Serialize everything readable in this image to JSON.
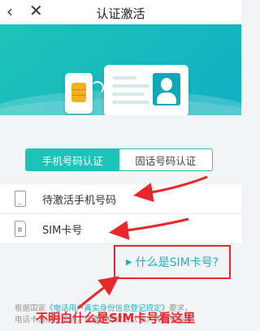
{
  "topbar": {
    "back_icon": "chevron-left-icon",
    "close_icon": "close-icon",
    "title": "认证激活"
  },
  "banner": {
    "illustration": "sim-card-and-id-card",
    "accent": "#1ec3b8"
  },
  "tabs": [
    {
      "label": "手机号码认证",
      "active": true
    },
    {
      "label": "固话号码认证",
      "active": false
    }
  ],
  "form": {
    "phone_placeholder": "待激活手机号码",
    "sim_placeholder": "SIM卡号"
  },
  "help": {
    "link_label": "什么是SIM卡号?"
  },
  "disclaimer": {
    "prefix": "根据国家",
    "regulation": "《电话用户真实身份信息登记规定》",
    "line1_suffix": "要求，",
    "line2": "电话卡激活使用前，需要进行实名认证。转售号码涉"
  },
  "annotation": {
    "text": "不明白什么是SIM卡号看这里",
    "color": "#e8262b"
  }
}
